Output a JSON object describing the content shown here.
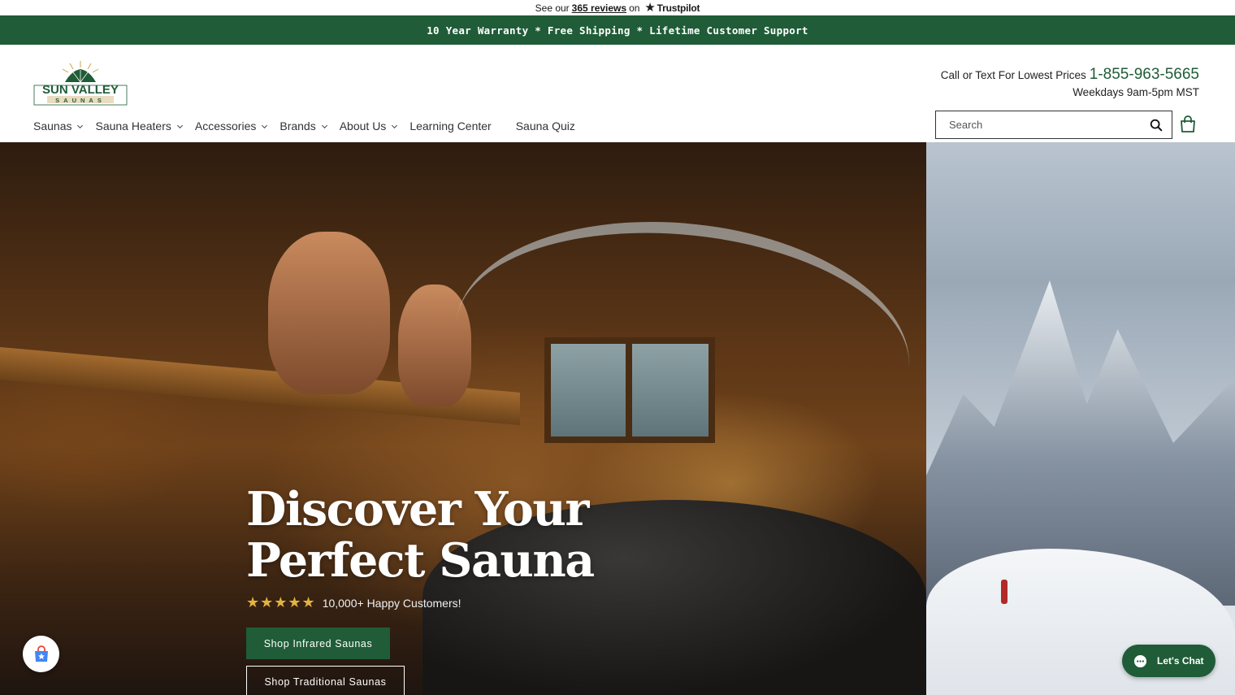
{
  "trustpilot": {
    "prefix": "See our",
    "reviews_link": "365 reviews",
    "suffix": "on",
    "brand": "Trustpilot"
  },
  "announcement": {
    "text": "10 Year Warranty * Free Shipping * Lifetime Customer Support"
  },
  "logo": {
    "name": "SUN VALLEY",
    "sub": "SAUNAS"
  },
  "contact": {
    "call_label": "Call or Text For Lowest Prices",
    "phone": "1-855-963-5665",
    "hours": "Weekdays 9am-5pm MST"
  },
  "nav": {
    "items": [
      {
        "label": "Saunas"
      },
      {
        "label": "Sauna Heaters"
      },
      {
        "label": "Accessories"
      },
      {
        "label": "Brands"
      },
      {
        "label": "About Us"
      },
      {
        "label": "Learning Center"
      },
      {
        "label": "Sauna Quiz"
      }
    ]
  },
  "search": {
    "placeholder": "Search"
  },
  "hero": {
    "title_line1": "Discover Your",
    "title_line2": "Perfect Sauna",
    "rating_stars": "★★★★★",
    "rating_text": "10,000+ Happy Customers!",
    "primary_cta": "Shop Infrared Saunas",
    "secondary_cta": "Shop Traditional Saunas"
  },
  "chat": {
    "label": "Let's Chat"
  },
  "colors": {
    "brand_green": "#1f5c37",
    "star_gold": "#e3b341"
  }
}
